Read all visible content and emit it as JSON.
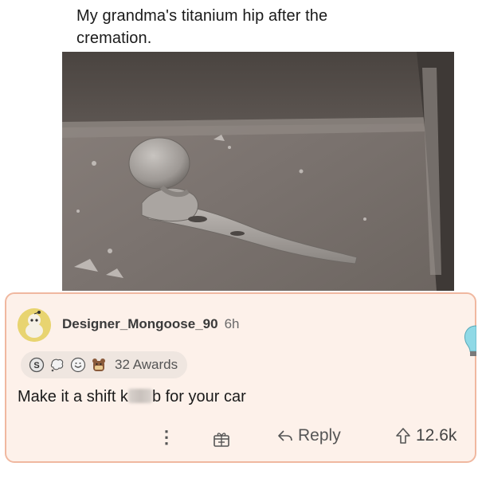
{
  "post": {
    "caption": "My grandma's titanium hip after the\ncremation."
  },
  "comment": {
    "username": "Designer_Mongoose_90",
    "timestamp": "6h",
    "awards_count_label": "32 Awards",
    "text_before": "Make it a shift k",
    "text_after": "b for your car",
    "award_icons": [
      "silver-award-icon",
      "thought-bubble-award-icon",
      "wholesome-award-icon",
      "bear-award-icon"
    ]
  },
  "actions": {
    "more_label": "⋮",
    "reply_label": "Reply",
    "upvotes": "12.6k"
  },
  "colors": {
    "card_background": "#fdf1ea",
    "card_border": "#f0b8a0",
    "avatar": "#e8d470"
  }
}
